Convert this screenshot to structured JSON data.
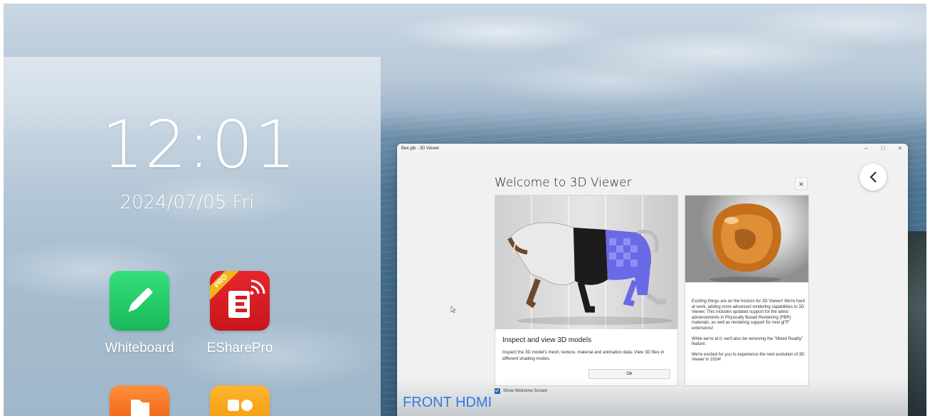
{
  "launcher": {
    "time": "12:01",
    "date": "2024/07/05 Fri",
    "apps": [
      {
        "label": "Whiteboard",
        "icon": "pencil-icon",
        "color": "#22c96a"
      },
      {
        "label": "ESharePro",
        "icon": "eshare-icon",
        "color": "#e0232a",
        "badge": "PRO"
      }
    ],
    "partial_apps": [
      {
        "icon": "folder-icon",
        "color": "#f57c28"
      },
      {
        "icon": "app-icon",
        "color": "#f9a81b"
      }
    ]
  },
  "viewer": {
    "window_title": "Bee.glb - 3D Viewer",
    "window_controls": [
      "–",
      "□",
      "×"
    ],
    "dialog": {
      "title": "Welcome to 3D Viewer",
      "close": "×",
      "left_card": {
        "heading": "Inspect and view 3D models",
        "description": "Inspect the 3D model's mesh, texture, material and animation data. View 3D files in different shading modes.",
        "ok_label": "Ok"
      },
      "right_card": {
        "paragraphs": [
          "Exciting things are on the horizon for 3D Viewer! We're hard at work, adding more advanced rendering capabilities to 3D Viewer. This includes updated support for the latest advancements in Physically Based Rendering (PBR) materials, as well as rendering support for new glTF extensions!",
          "While we're at it, we'll also be removing the \"Mixed Reality\" feature.",
          "We're excited for you to experience the next evolution of 3D Viewer in 2024!"
        ]
      },
      "show_welcome_label": "Show Welcome Screen",
      "show_welcome_checked": true
    }
  },
  "overlay": {
    "source_label": "FRONT HDMI"
  },
  "colors": {
    "accent": "#2c7be5",
    "checkbox": "#1f5fb0"
  }
}
